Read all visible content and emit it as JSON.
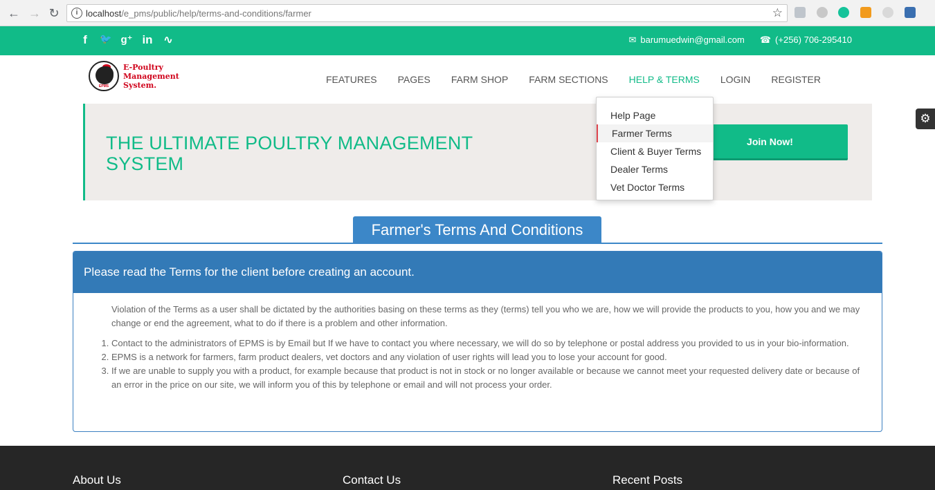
{
  "browser": {
    "url_host": "localhost",
    "url_path": "/e_pms/public/help/terms-and-conditions/farmer",
    "back_icon": "arrow-left-icon",
    "forward_icon": "arrow-right-icon",
    "reload_icon": "reload-icon",
    "info_icon": "info-icon",
    "star_icon": "star-icon"
  },
  "topbar": {
    "social_icons": [
      "facebook-icon",
      "twitter-icon",
      "google-plus-icon",
      "linkedin-icon",
      "rss-icon"
    ],
    "social_glyphs": [
      "f",
      "🐦",
      "g⁺",
      "in",
      "∿"
    ],
    "email": "barumuedwin@gmail.com",
    "phone": "(+256) 706-295410",
    "color": "#11bb88"
  },
  "logo": {
    "line1": "E-Poultry",
    "line2": "Management",
    "line3": "System.",
    "badge": "EPMS"
  },
  "menu": {
    "features": "FEATURES",
    "pages": "PAGES",
    "farm_shop": "FARM SHOP",
    "farm_sections": "FARM SECTIONS",
    "help_terms": "HELP & TERMS",
    "login": "LOGIN",
    "register": "REGISTER"
  },
  "dropdown": {
    "items": [
      "Help Page",
      "Farmer Terms",
      "Client & Buyer Terms",
      "Dealer Terms",
      "Vet Doctor Terms"
    ],
    "selected": "Farmer Terms"
  },
  "hero": {
    "title": "THE ULTIMATE POULTRY MANAGEMENT SYSTEM",
    "button": "Join Now!"
  },
  "section": {
    "title": "Farmer's Terms And Conditions"
  },
  "panel": {
    "heading": "Please read the Terms for the client before creating an account.",
    "intro": "Violation of the Terms as a user shall be dictated by the authorities basing on these terms as they (terms) tell you who we are, how we will provide the products to you, how you and we may change or end the agreement, what to do if there is a problem and other information.",
    "items": [
      "Contact to the administrators of EPMS is by Email but If we have to contact you where necessary, we will do so by telephone or postal address you provided to us in your bio-information.",
      "EPMS is a network for farmers, farm product dealers, vet doctors and any violation of user rights will lead you to lose your account for good.",
      "If we are unable to supply you with a product, for example because that product is not in stock or no longer available or because we cannot meet your requested delivery date or because of an error in the price on our site, we will inform you of this by telephone or email and will not process your order."
    ],
    "accent": "#337ab7"
  },
  "footer": {
    "about": "About Us",
    "contact": "Contact Us",
    "recent": "Recent Posts"
  }
}
